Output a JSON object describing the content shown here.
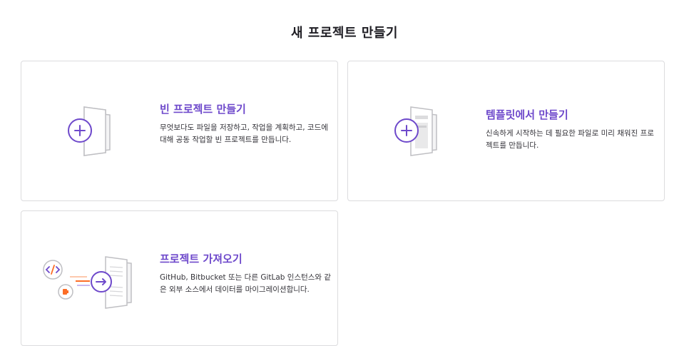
{
  "page": {
    "title": "새 프로젝트 만들기"
  },
  "cards": [
    {
      "title": "빈 프로젝트 만들기",
      "description": "무엇보다도 파일을 저장하고, 작업을 계획하고, 코드에 대해 공동 작업할 빈 프로젝트를 만듭니다.",
      "icon": "plus-icon"
    },
    {
      "title": "템플릿에서 만들기",
      "description": "신속하게 시작하는 데 필요한 파일로 미리 채워진 프로젝트를 만듭니다.",
      "icon": "plus-icon"
    },
    {
      "title": "프로젝트 가져오기",
      "description": "GitHub, Bitbucket 또는 다른 GitLab 인스턴스와 같은 외부 소스에서 데이터를 마이그레이션합니다.",
      "icon": "arrow-right-icon"
    }
  ],
  "colors": {
    "accent": "#6e49cb",
    "accent_light": "#e1d8f9",
    "orange": "#fc6d26",
    "border": "#dcdcde"
  }
}
